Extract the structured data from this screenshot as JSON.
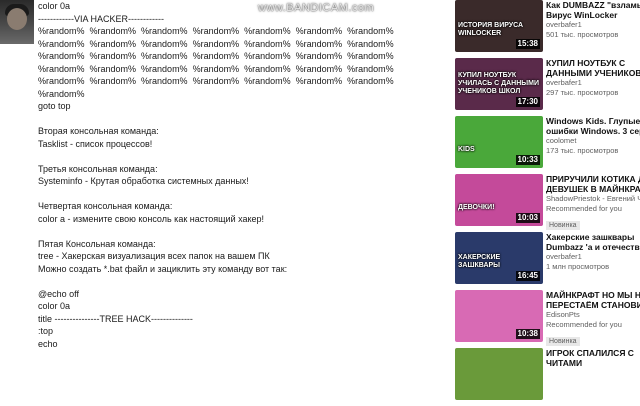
{
  "watermark": "www.BANDICAM.com",
  "article_lines": [
    "color 0a",
    "------------VIA HACKER------------",
    "%random%  %random%  %random%  %random%  %random%  %random%  %random%",
    "%random%  %random%  %random%  %random%  %random%  %random%  %random%",
    "%random%  %random%  %random%  %random%  %random%  %random%  %random%",
    "%random%  %random%  %random%  %random%  %random%  %random%  %random%",
    "%random%  %random%  %random%  %random%  %random%  %random%  %random%",
    "%random%",
    "goto top",
    "",
    "Вторая консольная команда:",
    "Tasklist - список процессов!",
    "",
    "Третья консольная команда:",
    "Systeminfo - Крутая обработка системных данных!",
    "",
    "Четвертая консольная команда:",
    "color a - измените свою консоль как настоящий хакер!",
    "",
    "Пятая Консольная команда:",
    "tree - Хакерская визуализация всех папок на вашем ПК",
    "Можно создать *.bat файл и зациклить эту команду вот так:",
    "",
    "@echo off",
    "color 0a",
    "title ---------------TREE HACK--------------",
    ":top",
    "echo"
  ],
  "videos": [
    {
      "title": "Как DUMBAZZ \"взламывает\"\nВирус WinLocker",
      "channel": "overbafer1",
      "views": "501 тыс. просмотров",
      "duration": "15:38",
      "caption": "история вируса\nWINLOCKER",
      "new": "",
      "bg": "#3a2a2a"
    },
    {
      "title": "КУПИЛ НОУТБУК С\nДАННЫМИ УЧЕНИКОВ И ИХ",
      "channel": "overbafer1",
      "views": "297 тыс. просмотров",
      "duration": "17:30",
      "caption": "купил ноутбук\nучилась с данными\nучеников школ",
      "new": "",
      "bg": "#5a2a4a"
    },
    {
      "title": "Windows Kids. Глупые\nошибки Windows. 3 серия",
      "channel": "coolomet",
      "views": "173 тыс. просмотров",
      "duration": "10:33",
      "caption": "Kids",
      "new": "",
      "bg": "#4aa83a"
    },
    {
      "title": "ПРИРУЧИЛИ КОТИКА ДЛЯ\nДЕВУШЕК В МАЙНКРАФТ! -",
      "channel": "ShadowPriestok - Евгений Ч...",
      "views": "Recommended for you",
      "duration": "10:03",
      "caption": "девочки!",
      "new": "Новинка",
      "bg": "#c44a9a"
    },
    {
      "title": "Хакерские зашквары\nDumbazz 'а и отечественного",
      "channel": "overbafer1",
      "views": "1 млн просмотров",
      "duration": "16:45",
      "caption": "хакерские\nзашквары",
      "new": "",
      "bg": "#2a3a6a"
    },
    {
      "title": "МАЙНКРАФТ НО МЫ НЕ\nПЕРЕСТАЁМ СТАНОВИТЬСЯ",
      "channel": "EdisonPts",
      "views": "Recommended for you",
      "duration": "10:38",
      "caption": "",
      "new": "Новинка",
      "bg": "#d86ab4"
    },
    {
      "title": "ИГРОК СПАЛИЛСЯ С\nЧИТАМИ",
      "channel": "",
      "views": "",
      "duration": "",
      "caption": "",
      "new": "",
      "bg": "#6a9a3a"
    }
  ]
}
